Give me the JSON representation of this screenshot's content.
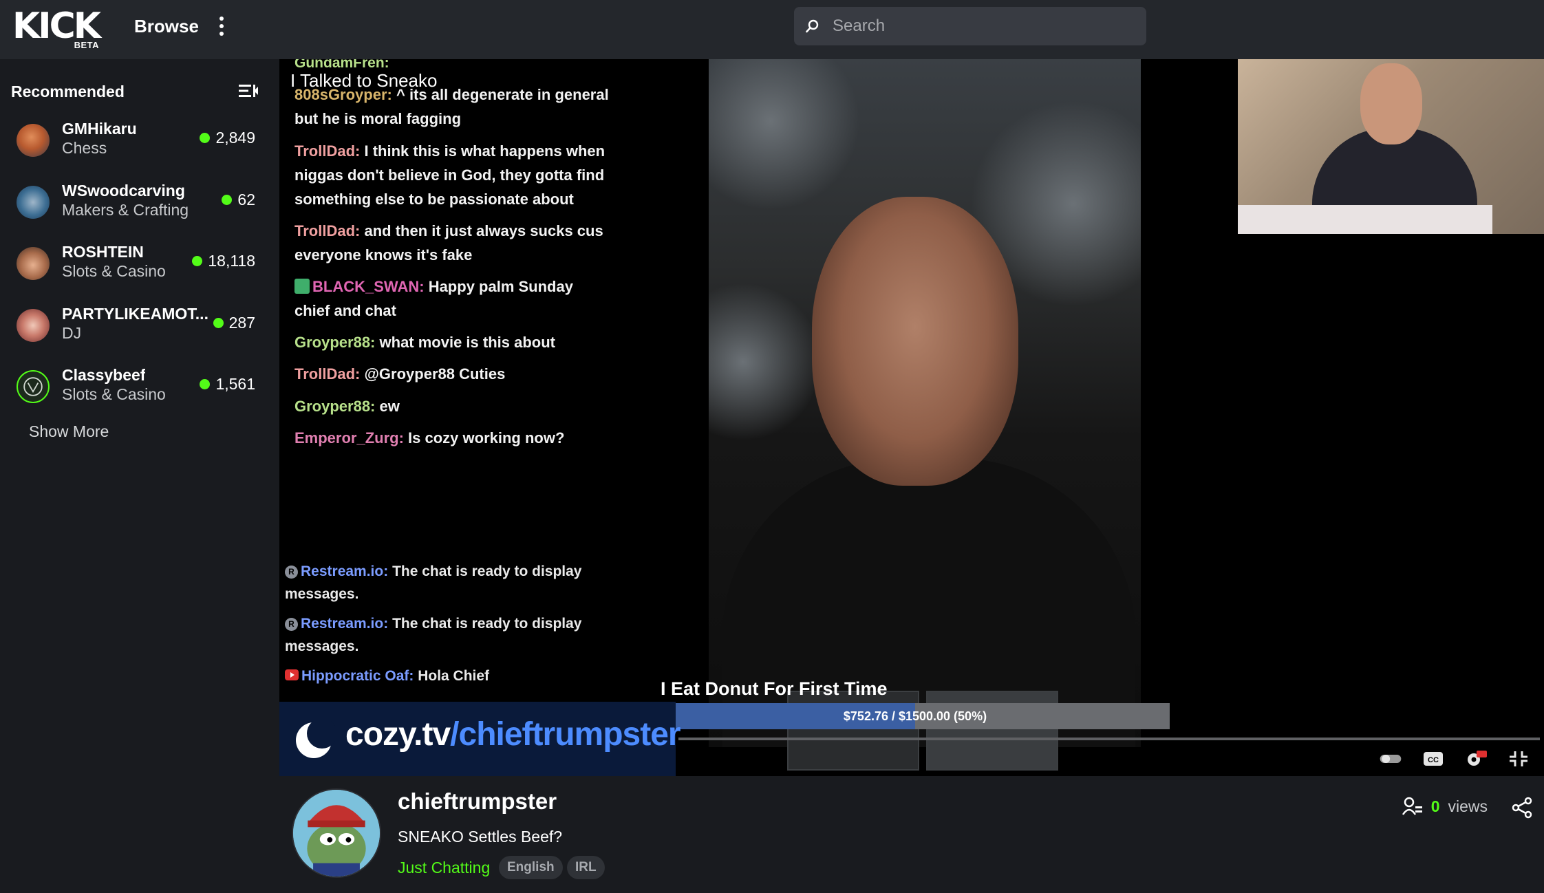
{
  "header": {
    "logo_text": "KICK",
    "logo_badge": "BETA",
    "browse_label": "Browse",
    "search_placeholder": "Search"
  },
  "sidebar": {
    "title": "Recommended",
    "channels": [
      {
        "name": "GMHikaru",
        "category": "Chess",
        "viewers": "2,849"
      },
      {
        "name": "WSwoodcarving",
        "category": "Makers & Crafting",
        "viewers": "62"
      },
      {
        "name": "ROSHTEIN",
        "category": "Slots & Casino",
        "viewers": "18,118"
      },
      {
        "name": "PARTYLIKEAMOT...",
        "category": "DJ",
        "viewers": "287"
      },
      {
        "name": "Classybeef",
        "category": "Slots & Casino",
        "viewers": "1,561"
      }
    ],
    "show_more": "Show More"
  },
  "player": {
    "overlay_top": "GundamFren:",
    "overlay_title": "I Talked to Sneako",
    "chat": [
      {
        "user": "808sGroyper:",
        "text": "^ its all degenerate in general but he is moral fagging",
        "color": "#d8b56b"
      },
      {
        "user": "TrollDad:",
        "text": "I think this is what happens when niggas don't believe in God, they gotta find something else to be passionate about",
        "color": "#f0a0a0"
      },
      {
        "user": "TrollDad:",
        "text": "and then it just always sucks cus everyone knows it's fake",
        "color": "#f0a0a0"
      },
      {
        "user": "BLACK_SWAN:",
        "text": "Happy palm Sunday chief and chat",
        "color": "#e066b3"
      },
      {
        "user": "Groyper88:",
        "text": "what movie is this about",
        "color": "#b7e08a"
      },
      {
        "user": "TrollDad:",
        "text": "@Groyper88 Cuties",
        "color": "#f0a0a0"
      },
      {
        "user": "Groyper88:",
        "text": "ew",
        "color": "#b7e08a"
      },
      {
        "user": "Emperor_Zurg:",
        "text": "Is cozy working now?",
        "color": "#e07fb0"
      }
    ],
    "mention": "@Groyper88",
    "system_msgs": [
      {
        "user": "Restream.io:",
        "text": "The chat is ready to display messages."
      },
      {
        "user": "Restream.io:",
        "text": "The chat is ready to display messages."
      },
      {
        "user": "Hippocratic Oaf:",
        "text": "Hola Chief"
      }
    ],
    "donut_title": "I Eat Donut For First Time",
    "goal_text": "$752.76 / $1500.00 (50%)",
    "goal_fraction": 0.5,
    "banner_brand": "cozy.tv",
    "banner_path": "/chieftrumpster"
  },
  "stream_info": {
    "username": "chieftrumpster",
    "title": "SNEAKO Settles Beef?",
    "category": "Just Chatting",
    "tags": [
      "English",
      "IRL"
    ],
    "views_count": "0",
    "views_label": "views"
  },
  "colors": {
    "accent": "#53fc18",
    "topbar": "#24272c",
    "background": "#191b1f",
    "restream": "#7b9cff"
  }
}
